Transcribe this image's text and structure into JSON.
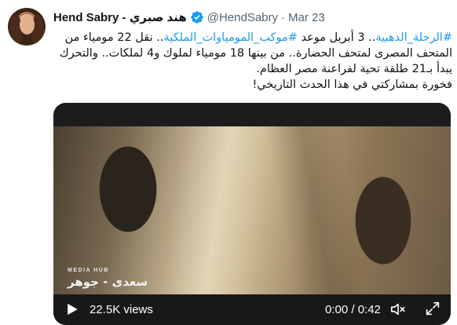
{
  "author": {
    "display_name": "Hend Sabry - هند صبري",
    "handle": "@HendSabry",
    "separator": "·",
    "date": "Mar 23",
    "verified": true,
    "avatar_icon": "profile-photo"
  },
  "tweet": {
    "line1_hashtag1": "#الرحلة_الذهبية",
    "line1_text1": ".. 3 أبريل موعد ",
    "line1_hashtag2": "#موكب_المومياوات_الملكية",
    "line1_text2": ".. نقل 22 مومياء من",
    "line2": "المتحف المصرى لمتحف الحضارة.. من بينها 18 مومياء لملوك و4 لملكات.. والتحرك",
    "line3": "يبدأ بـ21 طلقة تحية لفراعنة مصر العظام.",
    "line4": "فخورة بمشاركتي في هذا الحدث التاريخي!"
  },
  "video": {
    "watermark_top": "MEDIA HUB",
    "watermark_bottom": "سعدى - جوهر",
    "views": "22.5K views",
    "time": "0:00 / 0:42",
    "icons": {
      "play": "play-icon",
      "mute": "muted-speaker-icon",
      "fullscreen": "fullscreen-icon"
    }
  },
  "colors": {
    "link": "#1d9bf0",
    "secondary_text": "#536471",
    "primary_text": "#0f1419"
  }
}
